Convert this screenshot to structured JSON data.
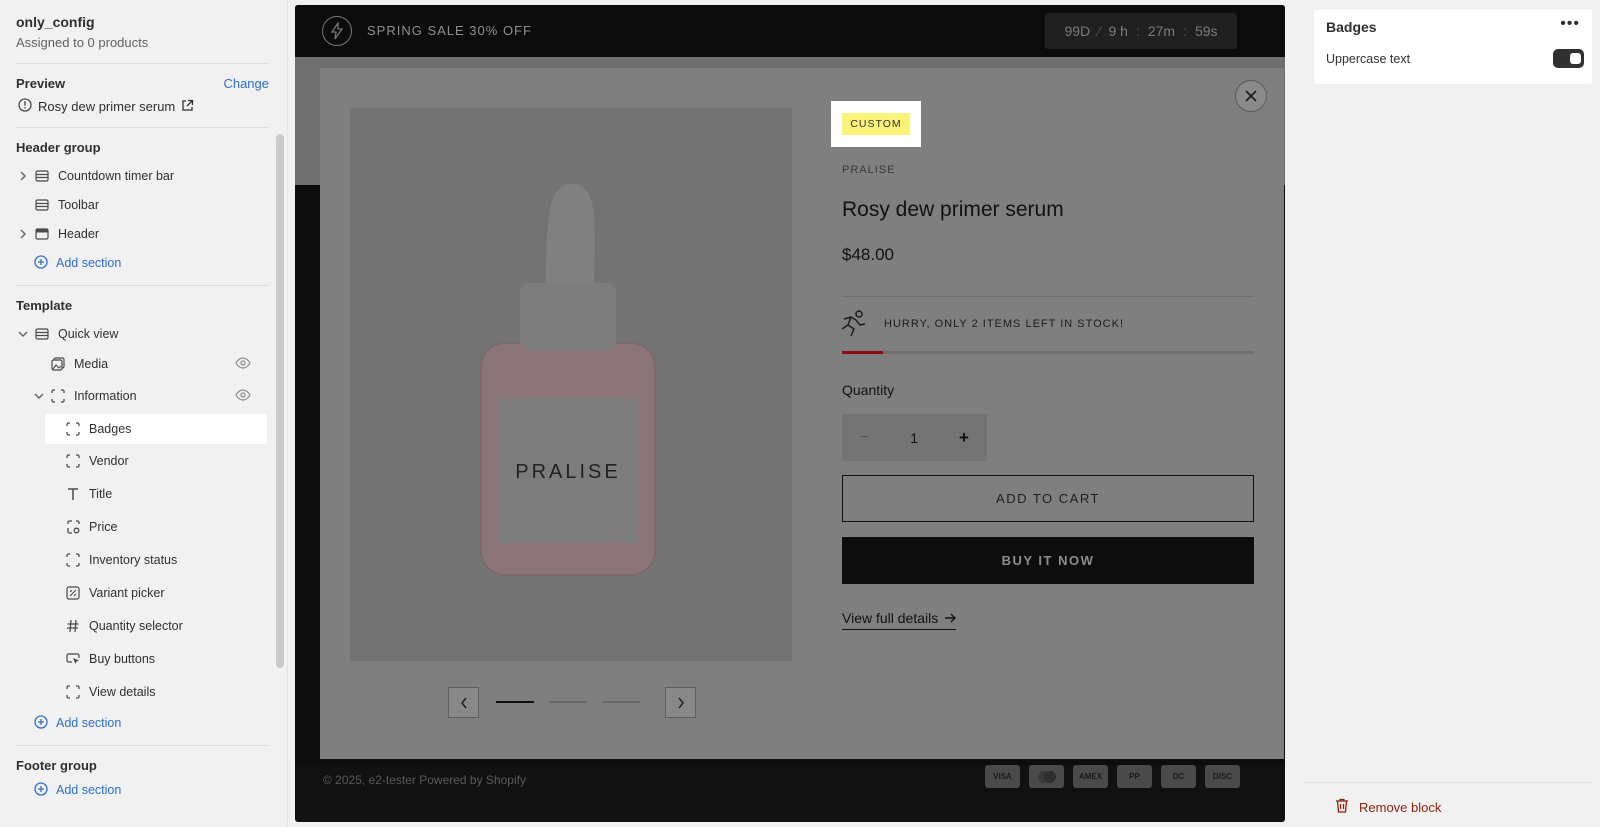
{
  "sidebar": {
    "config_name": "only_config",
    "assigned": "Assigned to 0 products",
    "preview": {
      "label": "Preview",
      "change": "Change",
      "product": "Rosy dew primer serum"
    },
    "header_group": {
      "title": "Header group",
      "items": [
        "Countdown timer bar",
        "Toolbar",
        "Header"
      ],
      "add": "Add section"
    },
    "template": {
      "title": "Template",
      "quick_view": "Quick view",
      "media": "Media",
      "information": "Information",
      "blocks": [
        "Badges",
        "Vendor",
        "Title",
        "Price",
        "Inventory status",
        "Variant picker",
        "Quantity selector",
        "Buy buttons",
        "View details"
      ],
      "add": "Add section"
    },
    "footer_group": {
      "title": "Footer group",
      "add": "Add section"
    }
  },
  "store": {
    "announcement": "SPRING SALE 30% OFF",
    "timer": {
      "days": "99D",
      "hours": "9 h",
      "minutes": "27m",
      "seconds": "59s"
    },
    "footer": "© 2025, e2-tester Powered by Shopify",
    "payments": [
      "VISA",
      "MC",
      "AMEX",
      "PP",
      "DC",
      "DISC"
    ]
  },
  "modal": {
    "badge": "CUSTOM",
    "vendor": "PRALISE",
    "title": "Rosy dew primer serum",
    "price": "$48.00",
    "inventory": {
      "text": "HURRY, ONLY 2 ITEMS LEFT IN STOCK!",
      "level": 0.1
    },
    "quantity_label": "Quantity",
    "quantity": "1",
    "add_to_cart": "ADD TO CART",
    "buy_now": "BUY IT NOW",
    "view_details": "View full details",
    "bottle_label": "PRALISE",
    "slides": 3,
    "active_slide": 1
  },
  "panel": {
    "title": "Badges",
    "setting_label": "Uppercase text",
    "uppercase_enabled": true,
    "remove": "Remove block"
  }
}
